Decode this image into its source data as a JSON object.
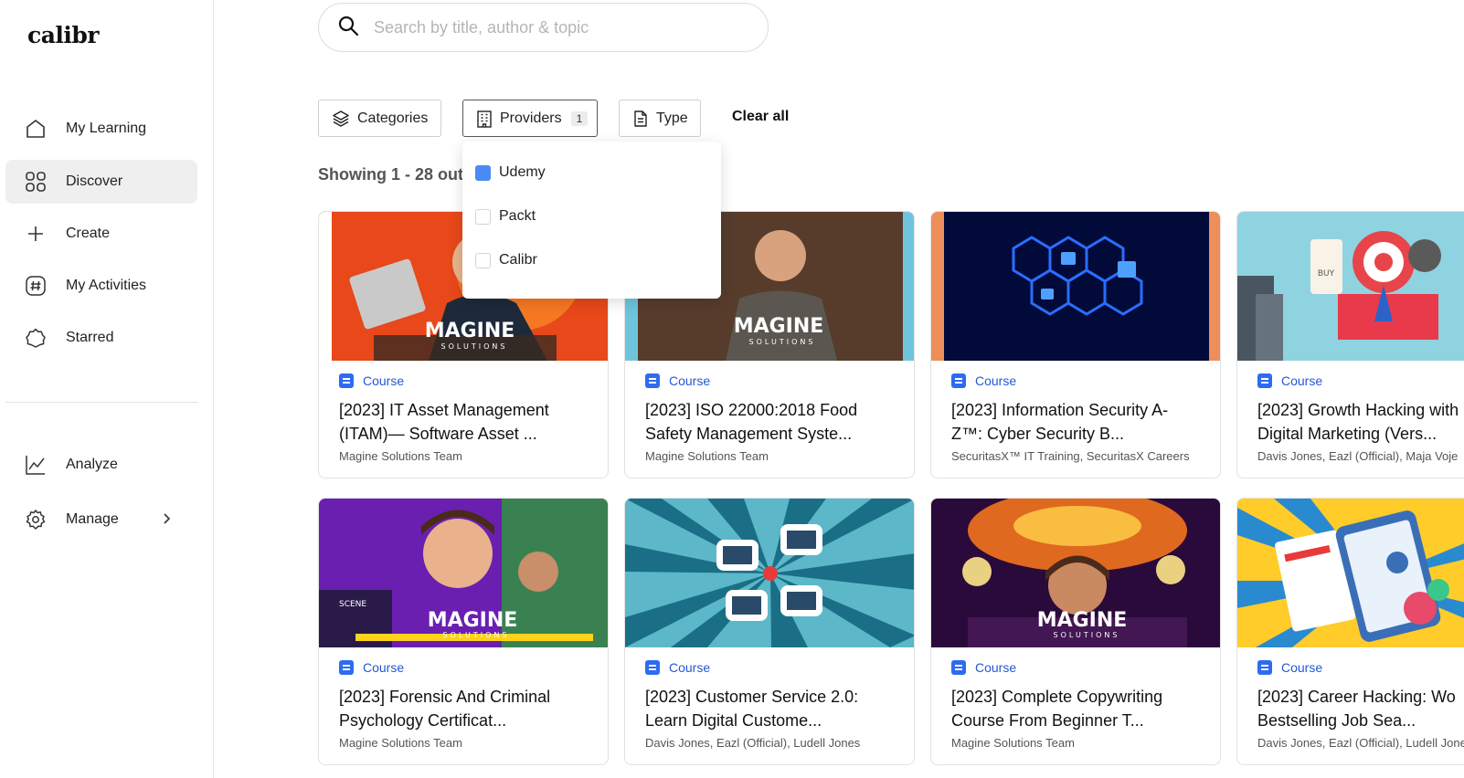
{
  "brand": {
    "logo_text": "calibr"
  },
  "sidebar": {
    "items": [
      {
        "label": "My Learning",
        "icon": "home-icon"
      },
      {
        "label": "Discover",
        "icon": "grid-icon",
        "active": true
      },
      {
        "label": "Create",
        "icon": "plus-icon"
      },
      {
        "label": "My Activities",
        "icon": "hashtag-icon"
      },
      {
        "label": "Starred",
        "icon": "star-icon"
      }
    ],
    "secondary": [
      {
        "label": "Analyze",
        "icon": "chart-line-icon"
      },
      {
        "label": "Manage",
        "icon": "gear-icon"
      }
    ]
  },
  "search": {
    "placeholder": "Search by title, author & topic",
    "value": ""
  },
  "filters": {
    "categories_label": "Categories",
    "providers_label": "Providers",
    "providers_count": "1",
    "type_label": "Type",
    "clear_all_label": "Clear all"
  },
  "results": {
    "showing_text": "Showing 1 - 28 out"
  },
  "providers_dropdown": {
    "options": [
      {
        "label": "Udemy",
        "checked": true
      },
      {
        "label": "Packt",
        "checked": false
      },
      {
        "label": "Calibr",
        "checked": false
      }
    ]
  },
  "cards": [
    {
      "type": "Course",
      "title": "[2023] IT Asset Management\n(ITAM)— Software Asset ...",
      "author": "Magine Solutions Team"
    },
    {
      "type": "Course",
      "title": "[2023] ISO 22000:2018 Food\nSafety Management Syste...",
      "author": "Magine Solutions Team"
    },
    {
      "type": "Course",
      "title": "[2023] Information Security A-\nZ™: Cyber Security B...",
      "author": "SecuritasX™ IT Training, SecuritasX Careers"
    },
    {
      "type": "Course",
      "title": "[2023] Growth Hacking with\nDigital Marketing (Vers...",
      "author": "Davis Jones, Eazl (Official), Maja Voje"
    },
    {
      "type": "Course",
      "title": "[2023] Forensic And Criminal\nPsychology Certificat...",
      "author": "Magine Solutions Team"
    },
    {
      "type": "Course",
      "title": "[2023] Customer Service 2.0:\nLearn Digital Custome...",
      "author": "Davis Jones, Eazl (Official), Ludell Jones"
    },
    {
      "type": "Course",
      "title": "[2023] Complete Copywriting\nCourse From Beginner T...",
      "author": "Magine Solutions Team"
    },
    {
      "type": "Course",
      "title": "[2023] Career Hacking: Wo\nBestselling Job Sea...",
      "author": "Davis Jones, Eazl (Official), Ludell Jones"
    }
  ],
  "thumb_text": {
    "magine": "MAGINE",
    "solutions": "SOLUTIONS",
    "buy": "BUY",
    "scene": "SCENE"
  },
  "colors": {
    "accent": "#2f6bf0",
    "checkbox_checked": "#4a8af4",
    "active_nav_bg": "#efefef"
  }
}
